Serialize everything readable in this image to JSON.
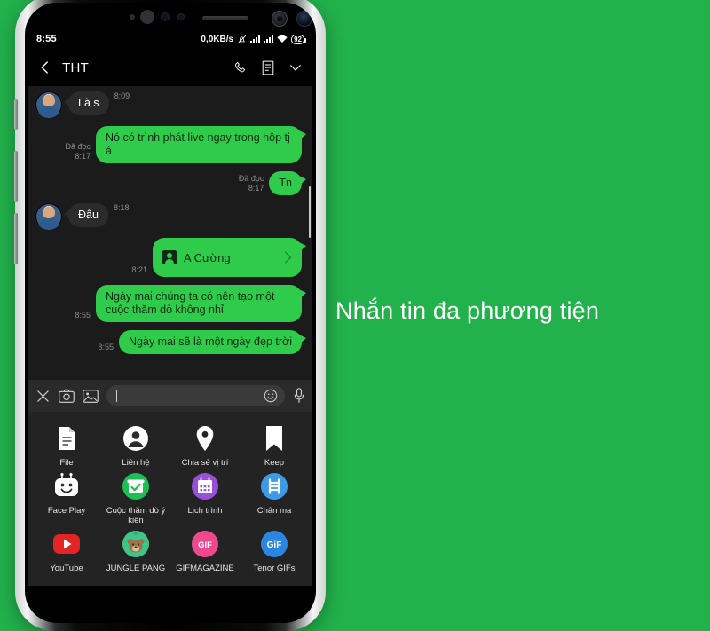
{
  "page": {
    "background_color": "#22b24c",
    "caption": "Nhắn tin đa phương tiện"
  },
  "phone": {
    "statusbar": {
      "time": "8:55",
      "network_speed": "0,0KB/s",
      "mute_icon": "bell-muted-icon",
      "signal_icon_1": "signal-bars-icon",
      "signal_icon_2": "signal-bars-icon",
      "wifi_icon": "wifi-icon",
      "battery_level": "92"
    },
    "header": {
      "back_icon": "chevron-left-icon",
      "title": "THT",
      "call_icon": "phone-icon",
      "notes_icon": "note-list-icon",
      "collapse_icon": "chevron-down-icon"
    },
    "messages": [
      {
        "direction": "in",
        "type": "text",
        "text": "Là s",
        "time": "8:09",
        "read_label": "",
        "avatar": true
      },
      {
        "direction": "out",
        "type": "text",
        "text": "Nó có trình phát live ngay trong hộp tj á",
        "time": "8:17",
        "read_label": "Đã đọc",
        "avatar": false
      },
      {
        "direction": "out",
        "type": "text",
        "text": "Tn",
        "time": "8:17",
        "read_label": "Đã đọc",
        "avatar": false
      },
      {
        "direction": "in",
        "type": "text",
        "text": "Đâu",
        "time": "8:18",
        "read_label": "",
        "avatar": true
      },
      {
        "direction": "out",
        "type": "contact",
        "text": "A Cường",
        "time": "8:21",
        "read_label": "",
        "avatar": false
      },
      {
        "direction": "out",
        "type": "text",
        "text": "Ngày mai chúng ta có nên tạo một cuộc thăm dò không nhỉ",
        "time": "8:55",
        "read_label": "",
        "avatar": false
      },
      {
        "direction": "out",
        "type": "text",
        "text": "Ngày mai sẽ là một ngày đẹp trời",
        "time": "8:55",
        "read_label": "",
        "avatar": false
      }
    ],
    "inputbar": {
      "close_icon": "close-icon",
      "camera_icon": "camera-icon",
      "gallery_icon": "image-icon",
      "input_value": "",
      "input_placeholder": "",
      "emoji_icon": "emoji-smiley-icon",
      "mic_icon": "microphone-icon"
    },
    "attachments": [
      {
        "label": "File",
        "icon": "document-icon",
        "color": "#ffffff"
      },
      {
        "label": "Liên hệ",
        "icon": "contact-icon",
        "color": "#ffffff"
      },
      {
        "label": "Chia sẻ vị trí",
        "icon": "location-pin-icon",
        "color": "#ffffff"
      },
      {
        "label": "Keep",
        "icon": "bookmark-icon",
        "color": "#ffffff"
      },
      {
        "label": "Face Play",
        "icon": "robot-face-icon",
        "color": "#ffffff"
      },
      {
        "label": "Cuộc thăm dò ý kiến",
        "icon": "poll-icon",
        "color": "#1ebd55"
      },
      {
        "label": "Lịch trình",
        "icon": "calendar-icon",
        "color": "#9a4fd8"
      },
      {
        "label": "Chân ma",
        "icon": "ladder-icon",
        "color": "#3d9ae8"
      },
      {
        "label": "YouTube",
        "icon": "youtube-icon",
        "color": "#e32424"
      },
      {
        "label": "JUNGLE PANG",
        "icon": "jungle-pang-icon",
        "color": "#3fc48a"
      },
      {
        "label": "GIFMAGAZINE",
        "icon": "gif-magazine-icon",
        "color": "#f0488f"
      },
      {
        "label": "Tenor GIFs",
        "icon": "tenor-gif-icon",
        "color": "#2a86e0"
      }
    ]
  }
}
